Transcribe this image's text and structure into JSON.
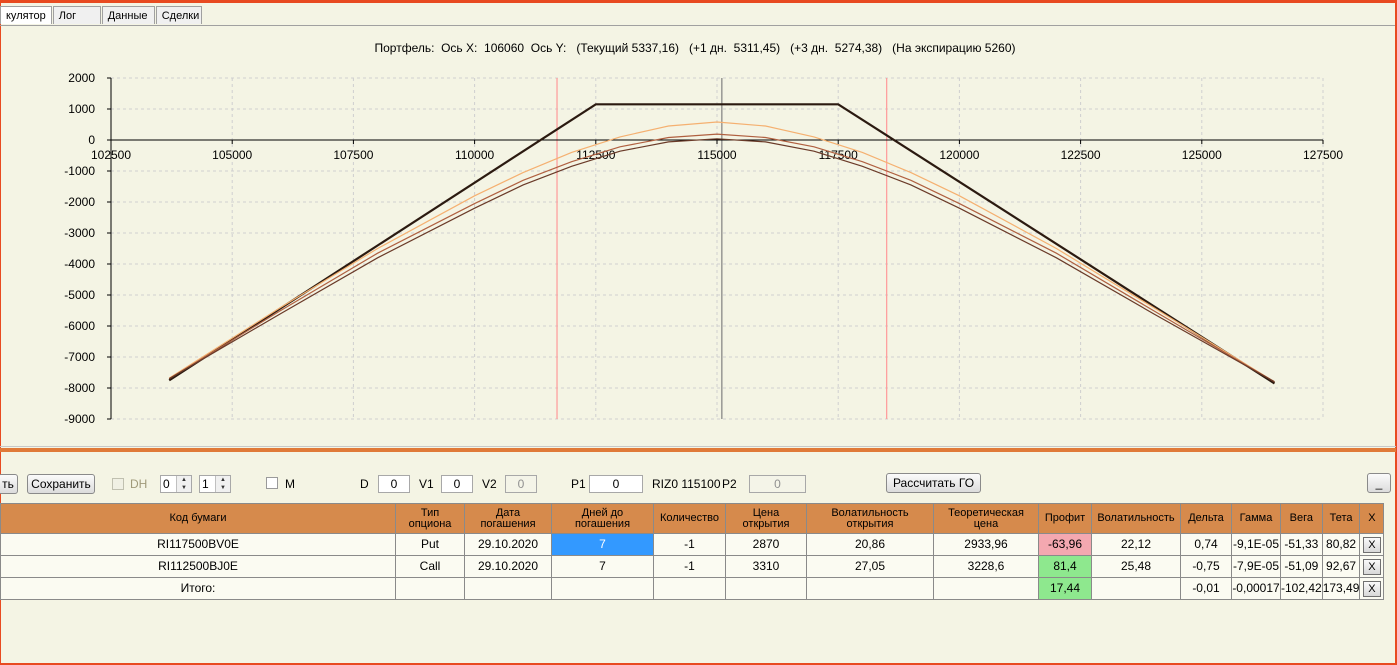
{
  "tabs": [
    "кулятор",
    "Лог",
    "Данные",
    "Сделки"
  ],
  "chart_data": {
    "type": "line",
    "title": "Портфель:  Ось X:  106060  Ось Y:   (Текущий 5337,16)   (+1 дн.  5311,45)   (+3 дн.  5274,38)   (На экспирацию 5260)",
    "xlim": [
      102500,
      127500
    ],
    "ylim": [
      -9000,
      2000
    ],
    "x_ticks": [
      "102500",
      "105000",
      "107500",
      "110000",
      "112500",
      "115000",
      "117500",
      "120000",
      "122500",
      "125000",
      "127500"
    ],
    "y_ticks": [
      "2000",
      "1000",
      "0",
      "-1000",
      "-2000",
      "-3000",
      "-4000",
      "-5000",
      "-6000",
      "-7000",
      "-8000",
      "-9000"
    ],
    "grid": true,
    "vertical_markers": [
      {
        "x": 111700,
        "color": "#ff9999"
      },
      {
        "x": 115100,
        "color": "#808080"
      },
      {
        "x": 118500,
        "color": "#ff9999"
      }
    ],
    "series": [
      {
        "color": "#2b1a10",
        "width": 2.2,
        "points": [
          [
            103700,
            -7750
          ],
          [
            112500,
            1150
          ],
          [
            117500,
            1150
          ],
          [
            126500,
            -7850
          ]
        ]
      },
      {
        "color": "#f5b070",
        "width": 1.2,
        "points": [
          [
            103700,
            -7680
          ],
          [
            106000,
            -5400
          ],
          [
            108000,
            -3500
          ],
          [
            110000,
            -1800
          ],
          [
            111000,
            -1050
          ],
          [
            112000,
            -400
          ],
          [
            113000,
            100
          ],
          [
            114000,
            450
          ],
          [
            115000,
            580
          ],
          [
            116000,
            450
          ],
          [
            117000,
            100
          ],
          [
            118000,
            -400
          ],
          [
            119000,
            -1050
          ],
          [
            120000,
            -1800
          ],
          [
            122000,
            -3500
          ],
          [
            124000,
            -5400
          ],
          [
            126500,
            -7800
          ]
        ]
      },
      {
        "color": "#b06040",
        "width": 1.2,
        "points": [
          [
            103700,
            -7700
          ],
          [
            106000,
            -5500
          ],
          [
            108000,
            -3650
          ],
          [
            110000,
            -2050
          ],
          [
            111000,
            -1300
          ],
          [
            112000,
            -700
          ],
          [
            113000,
            -220
          ],
          [
            114000,
            80
          ],
          [
            115000,
            190
          ],
          [
            116000,
            80
          ],
          [
            117000,
            -220
          ],
          [
            118000,
            -700
          ],
          [
            119000,
            -1300
          ],
          [
            120000,
            -2050
          ],
          [
            122000,
            -3650
          ],
          [
            124000,
            -5500
          ],
          [
            126500,
            -7800
          ]
        ]
      },
      {
        "color": "#6a3a28",
        "width": 1.2,
        "points": [
          [
            103700,
            -7700
          ],
          [
            106000,
            -5600
          ],
          [
            108000,
            -3800
          ],
          [
            110000,
            -2200
          ],
          [
            111000,
            -1450
          ],
          [
            112000,
            -850
          ],
          [
            113000,
            -360
          ],
          [
            114000,
            -60
          ],
          [
            115000,
            40
          ],
          [
            116000,
            -60
          ],
          [
            117000,
            -360
          ],
          [
            118000,
            -850
          ],
          [
            119000,
            -1450
          ],
          [
            120000,
            -2200
          ],
          [
            122000,
            -3800
          ],
          [
            124000,
            -5600
          ],
          [
            126500,
            -7800
          ]
        ]
      }
    ]
  },
  "toolbar": {
    "left_btn": "ть",
    "save": "Сохранить",
    "dh": "DH",
    "spin1": "0",
    "spin2": "1",
    "m": "M",
    "d_label": "D",
    "d_value": "0",
    "v1_label": "V1",
    "v1_value": "0",
    "v2_label": "V2",
    "v2_value": "0",
    "p1_label": "P1",
    "p1_value": "0",
    "riz": "RIZ0 115100",
    "p2_label": "P2",
    "p2_value": "0",
    "calc_go": "Рассчитать ГО",
    "minimize": "_"
  },
  "table": {
    "headers": [
      "Код бумаги",
      "Тип\nопциона",
      "Дата\nпогашения",
      "Дней до\nпогашения",
      "Количество",
      "Цена\nоткрытия",
      "Волатильность\nоткрытия",
      "Теоретическая\nцена",
      "Профит",
      "Волатильность",
      "Дельта",
      "Гамма",
      "Вега",
      "Тета",
      "X"
    ],
    "rows": [
      [
        "RI117500BV0E",
        "Put",
        "29.10.2020",
        "7",
        "-1",
        "2870",
        "20,86",
        "2933,96",
        "-63,96",
        "22,12",
        "0,74",
        "-9,1E-05",
        "-51,33",
        "80,82",
        "X"
      ],
      [
        "RI112500BJ0E",
        "Call",
        "29.10.2020",
        "7",
        "-1",
        "3310",
        "27,05",
        "3228,6",
        "81,4",
        "25,48",
        "-0,75",
        "-7,9E-05",
        "-51,09",
        "92,67",
        "X"
      ],
      [
        "Итого:",
        "",
        "",
        "",
        "",
        "",
        "",
        "",
        "17,44",
        "",
        "-0,01",
        "-0,00017",
        "-102,42",
        "173,49",
        "X"
      ]
    ],
    "profit_colors": {
      "negative": "#f4a8b0",
      "positive": "#8ee88e"
    },
    "selected_color": "#3399ff"
  }
}
